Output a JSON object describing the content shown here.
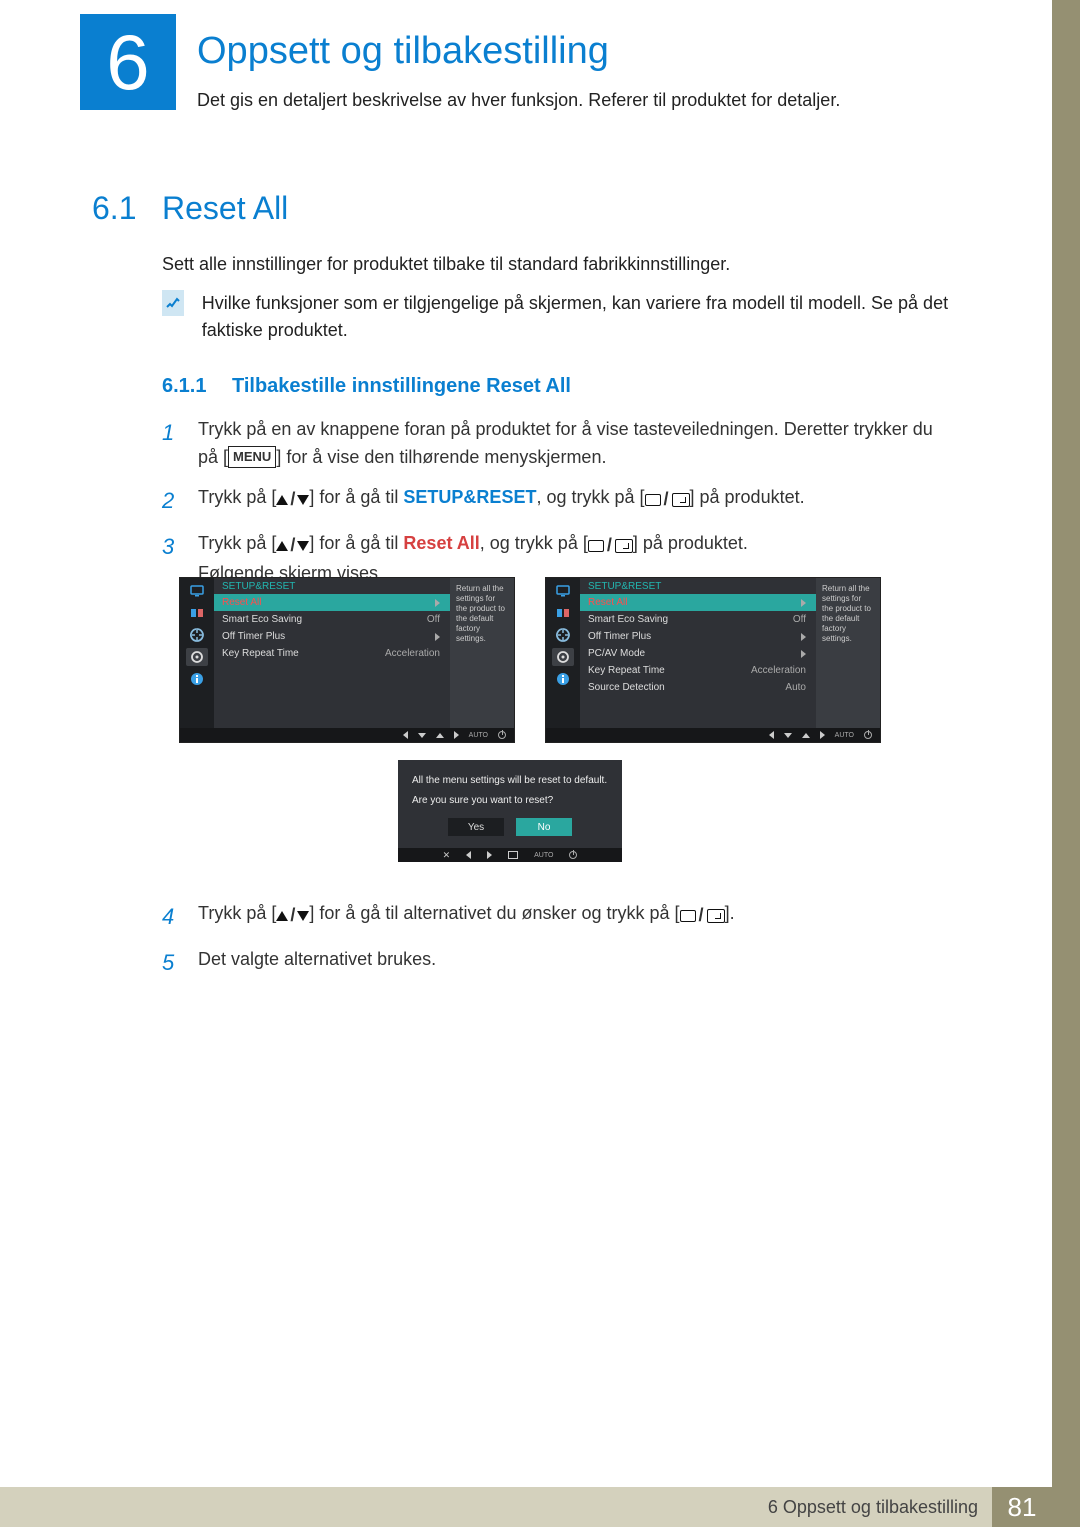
{
  "chapter": {
    "number": "6",
    "title": "Oppsett og tilbakestilling",
    "intro": "Det gis en detaljert beskrivelse av hver funksjon. Referer til produktet for detaljer."
  },
  "section": {
    "number": "6.1",
    "title": "Reset All",
    "body": "Sett alle innstillinger for produktet tilbake til standard fabrikkinnstillinger.",
    "note": "Hvilke funksjoner som er tilgjengelige på skjermen, kan variere fra modell til modell. Se på det faktiske produktet."
  },
  "subsection": {
    "number": "6.1.1",
    "title": "Tilbakestille innstillingene Reset All"
  },
  "steps": {
    "s1a": "Trykk på en av knappene foran på produktet for å vise tasteveiledningen. Deretter trykker du på [",
    "menu": "MENU",
    "s1b": "] for å vise den tilhørende menyskjermen.",
    "s2a": "Trykk på [",
    "s2b": "] for å gå til ",
    "s2bold": "SETUP&RESET",
    "s2c": ", og trykk på [",
    "s2d": "] på produktet.",
    "s3a": "Trykk på [",
    "s3b": "] for å gå til ",
    "s3bold": "Reset All",
    "s3c": ", og trykk på [",
    "s3d": "] på produktet.",
    "s3e": "Følgende skjerm vises.",
    "s4a": "Trykk på [",
    "s4b": "] for å gå til alternativet du ønsker og trykk på [",
    "s4c": "].",
    "s5": "Det valgte alternativet brukes.",
    "n1": "1",
    "n2": "2",
    "n3": "3",
    "n4": "4",
    "n5": "5"
  },
  "osd": {
    "header": "SETUP&RESET",
    "desc": "Return all the settings for the product to the default factory settings.",
    "footer_auto": "AUTO",
    "left": {
      "rows": [
        {
          "label": "Reset All",
          "value": "",
          "selected": true,
          "arrow": true
        },
        {
          "label": "Smart Eco Saving",
          "value": "Off"
        },
        {
          "label": "Off Timer Plus",
          "value": "",
          "arrow": true
        },
        {
          "label": "Key Repeat Time",
          "value": "Acceleration"
        }
      ]
    },
    "right": {
      "rows": [
        {
          "label": "Reset All",
          "value": "",
          "selected": true,
          "arrow": true
        },
        {
          "label": "Smart Eco Saving",
          "value": "Off"
        },
        {
          "label": "Off Timer Plus",
          "value": "",
          "arrow": true
        },
        {
          "label": "PC/AV Mode",
          "value": "",
          "arrow": true
        },
        {
          "label": "Key Repeat Time",
          "value": "Acceleration"
        },
        {
          "label": "Source Detection",
          "value": "Auto"
        }
      ]
    }
  },
  "confirm": {
    "line1": "All the menu settings will be reset to default.",
    "line2": "Are you sure you want to reset?",
    "yes": "Yes",
    "no": "No",
    "footer_auto": "AUTO"
  },
  "footer": {
    "text": "6 Oppsett og tilbakestilling",
    "page": "81"
  }
}
